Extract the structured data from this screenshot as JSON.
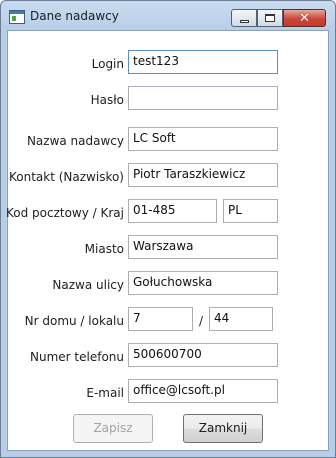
{
  "window": {
    "title": "Dane nadawcy",
    "icon": "app-window-icon"
  },
  "form": {
    "login": {
      "label": "Login",
      "value": "test123"
    },
    "password": {
      "label": "Hasło",
      "value": ""
    },
    "sender_name": {
      "label": "Nazwa nadawcy",
      "value": "LC Soft"
    },
    "contact": {
      "label": "Kontakt (Nazwisko)",
      "value": "Piotr Taraszkiewicz"
    },
    "postal": {
      "label": "Kod pocztowy / Kraj",
      "postal_code": "01-485",
      "country": "PL"
    },
    "city": {
      "label": "Miasto",
      "value": "Warszawa"
    },
    "street": {
      "label": "Nazwa ulicy",
      "value": "Gołuchowska"
    },
    "house": {
      "label": "Nr domu / lokalu",
      "house_no": "7",
      "separator": "/",
      "flat_no": "44"
    },
    "phone": {
      "label": "Numer telefonu",
      "value": "500600700"
    },
    "email": {
      "label": "E-mail",
      "value": "office@lcsoft.pl"
    }
  },
  "buttons": {
    "save": "Zapisz",
    "close": "Zamknij"
  },
  "colors": {
    "title_bar": "#b8cde6",
    "close_button": "#c8473a",
    "focus_border": "#5b8fbf"
  }
}
